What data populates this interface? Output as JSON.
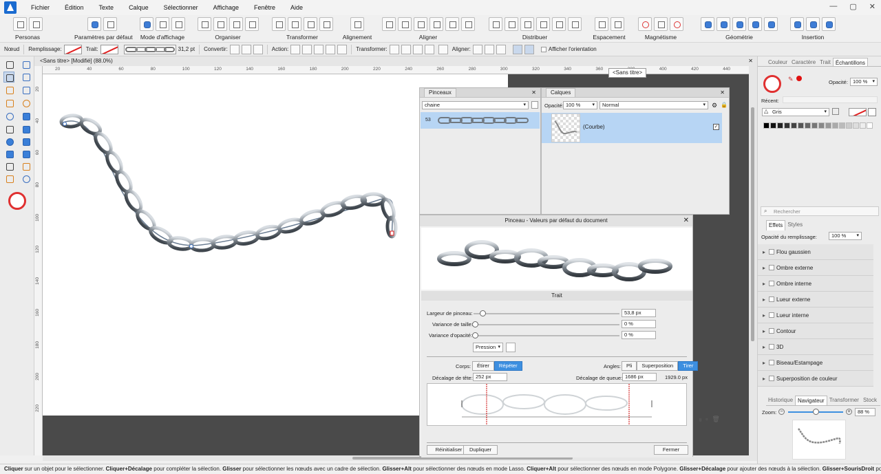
{
  "menubar": {
    "items": [
      "Fichier",
      "Édition",
      "Texte",
      "Calque",
      "Sélectionner",
      "Affichage",
      "Fenêtre",
      "Aide"
    ]
  },
  "toolbar": {
    "groups": [
      "Personas",
      "Paramètres par défaut",
      "Mode d'affichage",
      "Organiser",
      "Transformer",
      "Alignement",
      "Aligner",
      "Distribuer",
      "Espacement",
      "Magnétisme",
      "Géométrie",
      "Insertion"
    ]
  },
  "context": {
    "node_label": "Nœud",
    "fill_label": "Remplissage:",
    "stroke_label": "Trait:",
    "stroke_width": "31,2 pt",
    "convert_label": "Convertir:",
    "action_label": "Action:",
    "transform_label": "Transformer:",
    "align_label": "Aligner:",
    "show_orientation": "Afficher l'orientation"
  },
  "document": {
    "tab_title": "<Sans titre> [Modifié] (88.0%)",
    "tooltip": "<Sans titre>",
    "ruler_h": [
      "20",
      "40",
      "60",
      "80",
      "100",
      "120",
      "140",
      "160",
      "180",
      "200",
      "220",
      "240",
      "260",
      "280",
      "300",
      "320",
      "340",
      "360",
      "380",
      "400",
      "420",
      "440"
    ],
    "ruler_v": [
      "20",
      "40",
      "60",
      "80",
      "100",
      "120",
      "140",
      "160",
      "180",
      "200",
      "220"
    ]
  },
  "brushes_panel": {
    "tab": "Pinceaux",
    "category": "chaine",
    "brush_size": "53"
  },
  "layers_panel": {
    "tab": "Calques",
    "opacity_label": "Opacité:",
    "opacity": "100 %",
    "blend_mode": "Normal",
    "layer_name": "(Courbe)"
  },
  "brush_dialog": {
    "title": "Pinceau - Valeurs par défaut du document",
    "section": "Trait",
    "width_label": "Largeur de pinceau:",
    "width_value": "53,8 px",
    "width_fraction": 0.06,
    "size_var_label": "Variance de taille:",
    "size_var_value": "0 %",
    "opacity_var_label": "Variance d'opacité:",
    "opacity_var_value": "0 %",
    "pressure": "Pression",
    "body_label": "Corps:",
    "body_options": [
      "Étirer",
      "Répéter"
    ],
    "angles_label": "Angles:",
    "angles_options": [
      "Pli",
      "Superposition",
      "Tirer"
    ],
    "head_offset_label": "Décalage de tête:",
    "head_offset": "252 px",
    "tail_offset_label": "Décalage de queue:",
    "tail_offset": "1686 px",
    "total": "1929.0 px",
    "reset": "Réinitialiser",
    "duplicate": "Dupliquer",
    "close": "Fermer"
  },
  "right_panel": {
    "tabs": [
      "Couleur",
      "Caractère",
      "Trait",
      "Échantillons"
    ],
    "opacity_label": "Opacité:",
    "opacity": "100 %",
    "recent_label": "Récent:",
    "palette": "Gris",
    "grays": [
      "#000000",
      "#111111",
      "#222222",
      "#333333",
      "#444444",
      "#555555",
      "#666666",
      "#777777",
      "#888888",
      "#999999",
      "#aaaaaa",
      "#bbbbbb",
      "#cccccc",
      "#dddddd",
      "#eeeeee",
      "#ffffff"
    ],
    "search_placeholder": "Rechercher",
    "effects_tabs": [
      "Effets",
      "Styles"
    ],
    "fill_opacity_label": "Opacité du remplissage:",
    "fill_opacity": "100 %",
    "effects": [
      "Flou gaussien",
      "Ombre externe",
      "Ombre interne",
      "Lueur externe",
      "Lueur interne",
      "Contour",
      "3D",
      "Biseau/Estampage",
      "Superposition de couleur"
    ],
    "nav_tabs": [
      "Historique",
      "Navigateur",
      "Transformer",
      "Stock"
    ],
    "zoom_label": "Zoom:",
    "zoom": "88 %"
  },
  "status": {
    "text": "Cliquer sur un objet pour le sélectionner. Cliquer+Décalage pour compléter la sélection. Glisser pour sélectionner les nœuds avec un cadre de sélection. Glisser+Alt pour sélectionner des nœuds en mode Lasso. Cliquer+Alt pour sélectionner des nœuds en mode Polygone. Glisser+Décalage pour ajouter des nœuds à la sélection. Glisser+SourisDroit pour"
  },
  "colors": {
    "accent": "#3d8fe0",
    "selection": "#b7d5f4",
    "canvas_bg": "#4a4a4a"
  }
}
